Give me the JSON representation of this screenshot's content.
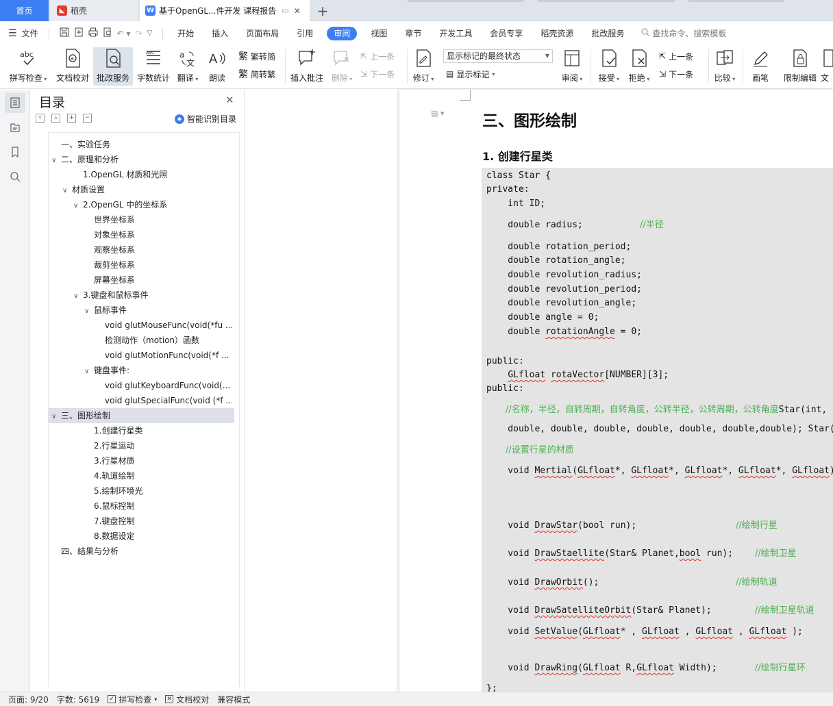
{
  "tabs": {
    "home": "首页",
    "daoke": "稻壳",
    "doc": "基于OpenGL...件开发 课程报告"
  },
  "menubar": {
    "file": "文件",
    "tabs": [
      "开始",
      "插入",
      "页面布局",
      "引用",
      "审阅",
      "视图",
      "章节",
      "开发工具",
      "会员专享",
      "稻壳资源",
      "批改服务"
    ],
    "active_tab": "审阅",
    "search": "查找命令、搜索模板"
  },
  "ribbon": {
    "spell": "拼写检查",
    "proof": "文档校对",
    "grade": "批改服务",
    "wordcount": "字数统计",
    "translate": "翻译",
    "read": "朗读",
    "trad": "繁转简",
    "simp": "简转繁",
    "insert_comment": "插入批注",
    "delete": "删除",
    "prev_comment": "上一条",
    "next_comment": "下一条",
    "revise": "修订",
    "markup_state": "显示标记的最终状态",
    "show_markup": "显示标记",
    "review": "审阅",
    "accept": "接受",
    "reject": "拒绝",
    "prev": "上一条",
    "next": "下一条",
    "compare": "比较",
    "pen": "画笔",
    "restrict": "限制编辑",
    "last": "文"
  },
  "nav": {
    "title": "目录",
    "smart": "智能识别目录",
    "toc": [
      {
        "text": "一、实验任务",
        "chev": ""
      },
      {
        "text": "二、原理和分析",
        "chev": "∨"
      },
      {
        "text": "1.OpenGL 材质和光照",
        "chev": ""
      },
      {
        "text": "材质设置",
        "chev": "∨"
      },
      {
        "text": "2.OpenGL 中的坐标系",
        "chev": "∨"
      },
      {
        "text": "世界坐标系",
        "chev": ""
      },
      {
        "text": "对象坐标系",
        "chev": ""
      },
      {
        "text": "观察坐标系",
        "chev": ""
      },
      {
        "text": "裁剪坐标系",
        "chev": ""
      },
      {
        "text": "屏幕坐标系",
        "chev": ""
      },
      {
        "text": "3.键盘和鼠标事件",
        "chev": "∨"
      },
      {
        "text": "鼠标事件",
        "chev": "∨"
      },
      {
        "text": "void glutMouseFunc(void(*fu ...",
        "chev": ""
      },
      {
        "text": "检测动作（motion）函数",
        "chev": ""
      },
      {
        "text": "void glutMotionFunc(void(*f ...",
        "chev": ""
      },
      {
        "text": "键盘事件:",
        "chev": "∨"
      },
      {
        "text": "void glutKeyboardFunc(void(...",
        "chev": ""
      },
      {
        "text": "void glutSpecialFunc(void (*f ...",
        "chev": ""
      },
      {
        "text": "三、图形绘制",
        "chev": "∨"
      },
      {
        "text": "1.创建行星类",
        "chev": ""
      },
      {
        "text": "2.行星运动",
        "chev": ""
      },
      {
        "text": "3.行星材质",
        "chev": ""
      },
      {
        "text": "4.轨道绘制",
        "chev": ""
      },
      {
        "text": "5.绘制环境光",
        "chev": ""
      },
      {
        "text": "6.鼠标控制",
        "chev": ""
      },
      {
        "text": "7.键盘控制",
        "chev": ""
      },
      {
        "text": "8.数据设定",
        "chev": ""
      },
      {
        "text": "四、结果与分析",
        "chev": ""
      }
    ]
  },
  "doc": {
    "heading1": "三、图形绘制",
    "heading2": "1.  创建行星类",
    "code": {
      "l1": "class Star {",
      "l2": "private:",
      "l3": "    int ID;",
      "l4": "    double radius;",
      "l4c": "//半径",
      "l5": "    double rotation_period;",
      "l6": "    double rotation_angle;",
      "l7": "    double revolution_radius;",
      "l8": "    double revolution_period;",
      "l9": "    double revolution_angle;",
      "l10": "    double angle = 0;",
      "l11a": "    double ",
      "l11b": "rotationAngle",
      "l11c": " = 0;",
      "l12": "public:",
      "l13a": "    ",
      "l13b": "GLfloat",
      "l13c": " ",
      "l13d": "rotaVector",
      "l13e": "[NUMBER][3];",
      "l14": "public:",
      "l15c": "//名称，半径，自转周期，自转角度，公转半径，公转周期，公转角度",
      "l15": "Star(int,",
      "l16": "    double, double, double, double, double, double,double); Star();",
      "l17c": "//设置行星的材质",
      "l18a": "    void ",
      "l18b": "Mertial",
      "l18c": "(",
      "l18d": "GLfloat",
      "l18e": "*, ",
      "l18f": "GLfloat",
      "l18g": "*, ",
      "l18h": "GLfloat",
      "l18i": "*, ",
      "l18j": "GLfloat",
      "l18k": "*, ",
      "l18l": "GLfloat",
      "l18m": ");",
      "l19a": "    void ",
      "l19b": "DrawStar",
      "l19c": "(bool run);",
      "l19cm": "//绘制行星",
      "l20a": "    void ",
      "l20b": "DrawStaellite",
      "l20c": "(Star& Planet,",
      "l20d": "bool",
      "l20e": " run);",
      "l20cm": "//绘制卫星",
      "l21a": "    void ",
      "l21b": "DrawOrbit",
      "l21c": "();",
      "l21cm": "//绘制轨道",
      "l22a": "    void ",
      "l22b": "DrawSatelliteOrbit",
      "l22c": "(Star& Planet);",
      "l22cm": "//绘制卫星轨道",
      "l23a": "    void ",
      "l23b": "SetValue",
      "l23c": "(",
      "l23d": "GLfloat",
      "l23e": "* , ",
      "l23f": "GLfloat",
      "l23g": " , ",
      "l23h": "GLfloat",
      "l23i": " , ",
      "l23j": "GLfloat",
      "l23k": " );",
      "l24a": "    void ",
      "l24b": "DrawRing",
      "l24c": "(",
      "l24d": "GLfloat",
      "l24e": " R,",
      "l24f": "GLfloat",
      "l24g": " Width);",
      "l24cm": "//绘制行星环",
      "l25": "};"
    }
  },
  "status": {
    "page": "页面: 9/20",
    "words": "字数: 5619",
    "spell": "拼写检查",
    "proof": "文档校对",
    "compat": "兼容模式"
  },
  "colors": {
    "accent": "#3d7ef2",
    "comment": "#4caf50",
    "code_bg": "#e4e4e4"
  }
}
